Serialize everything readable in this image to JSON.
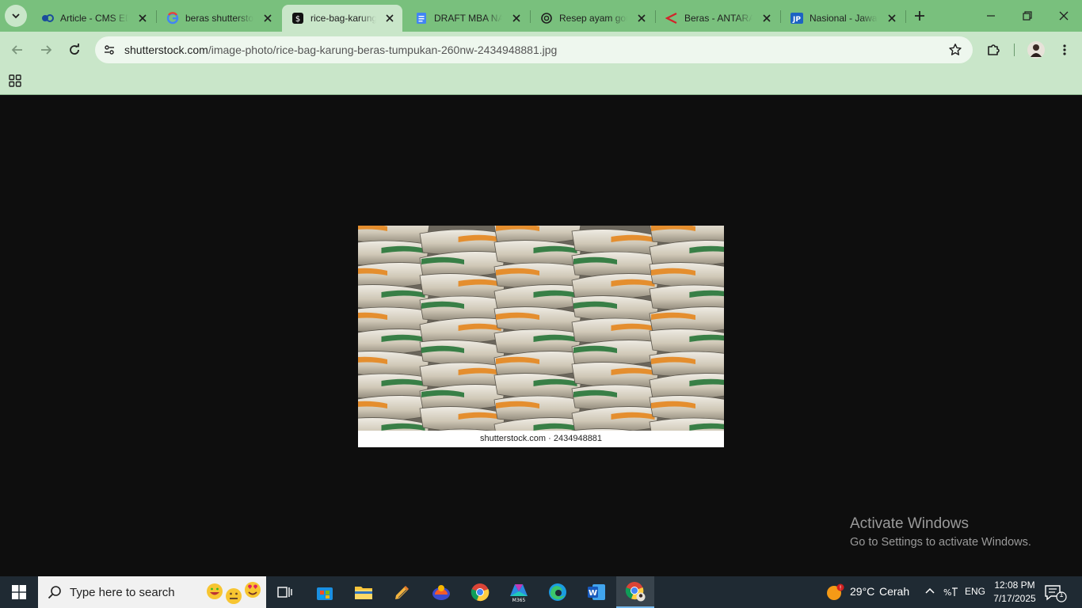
{
  "browser": {
    "tabs": [
      {
        "title": "Article - CMS ED",
        "favicon": "cms-logo-icon",
        "active": false
      },
      {
        "title": "beras shutterstock",
        "favicon": "google-g-icon",
        "active": false
      },
      {
        "title": "rice-bag-karung-beras-tumpukan",
        "favicon": "shutterstock-icon",
        "active": true
      },
      {
        "title": "DRAFT MBA NAT",
        "favicon": "google-docs-icon",
        "active": false
      },
      {
        "title": "Resep ayam goreng",
        "favicon": "chatgpt-icon",
        "active": false
      },
      {
        "title": "Beras - ANTARA",
        "favicon": "antara-icon",
        "active": false
      },
      {
        "title": "Nasional - Jawa Pos",
        "favicon": "jawapos-icon",
        "active": false
      }
    ],
    "url_domain": "shutterstock.com",
    "url_path": "/image-photo/rice-bag-karung-beras-tumpukan-260nw-2434948881.jpg",
    "theme_colors": {
      "tabstrip": "#79c07d",
      "toolbar": "#c9e6c9",
      "page_bg": "#0e0e0e"
    }
  },
  "image": {
    "caption": "shutterstock.com · 2434948881",
    "subject": "stacked rice sacks with orange and green stripes"
  },
  "watermark": {
    "title": "Activate Windows",
    "subtitle": "Go to Settings to activate Windows."
  },
  "taskbar": {
    "search_placeholder": "Type here to search",
    "apps": [
      "task-view",
      "microsoft-store",
      "file-explorer",
      "sticky-app",
      "paint-app",
      "chrome",
      "m365",
      "edge",
      "word",
      "chrome-profile"
    ],
    "weather_temp": "29°C",
    "weather_text": "Cerah",
    "language": "ENG",
    "time": "12:08 PM",
    "date": "7/17/2025",
    "notification_count": "1"
  }
}
